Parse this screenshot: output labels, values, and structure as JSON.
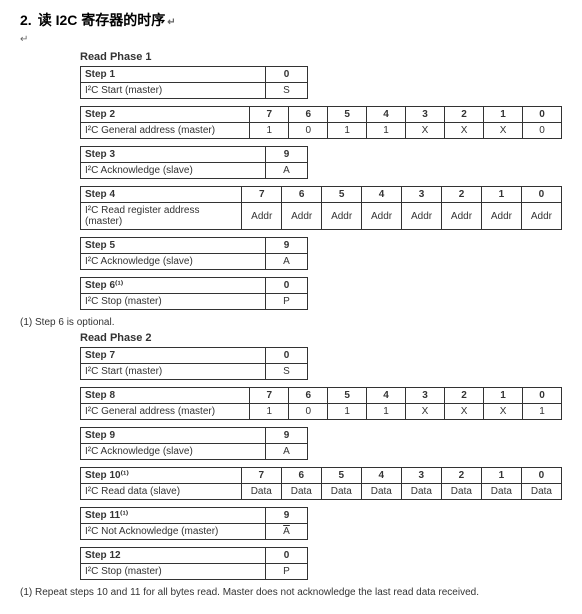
{
  "title": {
    "num": "2.",
    "text": "读 I2C 寄存器的时序"
  },
  "symbols": {
    "arrow": "↵",
    "ret": "↵"
  },
  "phase1": {
    "title": "Read Phase 1",
    "steps": [
      {
        "header": [
          "Step 1",
          "0"
        ],
        "row": [
          "I²C Start (master)",
          "S"
        ]
      },
      {
        "header": [
          "Step 2",
          "7",
          "6",
          "5",
          "4",
          "3",
          "2",
          "1",
          "0"
        ],
        "row": [
          "I²C General address (master)",
          "1",
          "0",
          "1",
          "1",
          "X",
          "X",
          "X",
          "0"
        ]
      },
      {
        "header": [
          "Step 3",
          "9"
        ],
        "row": [
          "I²C Acknowledge (slave)",
          "A"
        ]
      },
      {
        "header": [
          "Step 4",
          "7",
          "6",
          "5",
          "4",
          "3",
          "2",
          "1",
          "0"
        ],
        "row": [
          "I²C Read register address (master)",
          "Addr",
          "Addr",
          "Addr",
          "Addr",
          "Addr",
          "Addr",
          "Addr",
          "Addr"
        ]
      },
      {
        "header": [
          "Step 5",
          "9"
        ],
        "row": [
          "I²C Acknowledge (slave)",
          "A"
        ]
      },
      {
        "header": [
          "Step 6⁽¹⁾",
          "0"
        ],
        "row": [
          "I²C Stop (master)",
          "P"
        ]
      }
    ]
  },
  "footnote1": "(1)   Step 6 is optional.",
  "phase2": {
    "title": "Read Phase 2",
    "steps": [
      {
        "header": [
          "Step 7",
          "0"
        ],
        "row": [
          "I²C Start (master)",
          "S"
        ]
      },
      {
        "header": [
          "Step 8",
          "7",
          "6",
          "5",
          "4",
          "3",
          "2",
          "1",
          "0"
        ],
        "row": [
          "I²C General address (master)",
          "1",
          "0",
          "1",
          "1",
          "X",
          "X",
          "X",
          "1"
        ]
      },
      {
        "header": [
          "Step 9",
          "9"
        ],
        "row": [
          "I²C Acknowledge (slave)",
          "A"
        ]
      },
      {
        "header": [
          "Step 10⁽¹⁾",
          "7",
          "6",
          "5",
          "4",
          "3",
          "2",
          "1",
          "0"
        ],
        "row": [
          "I²C Read data (slave)",
          "Data",
          "Data",
          "Data",
          "Data",
          "Data",
          "Data",
          "Data",
          "Data"
        ]
      },
      {
        "header": [
          "Step 11⁽¹⁾",
          "9"
        ],
        "row": [
          "I²C Not Acknowledge (master)",
          "A",
          "overline"
        ]
      },
      {
        "header": [
          "Step 12",
          "0"
        ],
        "row": [
          "I²C Stop (master)",
          "P"
        ]
      }
    ]
  },
  "footnote2": "(1)   Repeat steps 10 and 11 for all bytes read. Master does not acknowledge the last read data received."
}
